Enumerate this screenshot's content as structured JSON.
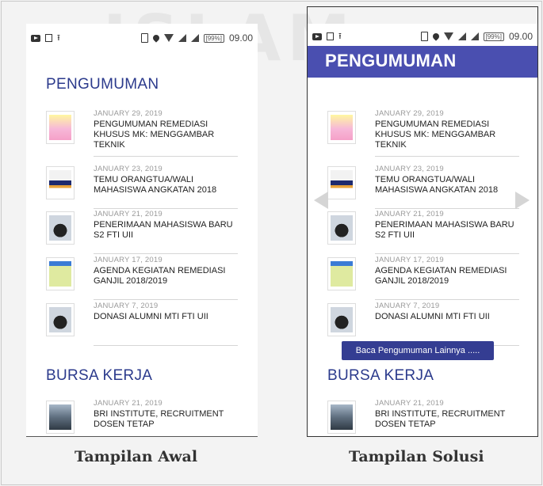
{
  "status": {
    "time": "09.00",
    "battery_label": "[99%]"
  },
  "left_panel": {
    "section_title": "PENGUMUMAN",
    "second_section_title": "BURSA KERJA",
    "caption": "Tampilan Awal"
  },
  "right_panel": {
    "section_title": "PENGUMUMAN",
    "second_section_title": "BURSA KERJA",
    "more_button": "Baca Pengumuman Lainnya .....",
    "caption": "Tampilan Solusi"
  },
  "announcements": [
    {
      "date": "JANUARY 29, 2019",
      "title": "PENGUMUMAN REMEDIASI KHUSUS MK: MENGGAMBAR TEKNIK",
      "thumb": "flyer"
    },
    {
      "date": "JANUARY 23, 2019",
      "title": "TEMU ORANGTUA/WALI MAHASISWA ANGKATAN 2018",
      "thumb": "banner"
    },
    {
      "date": "JANUARY 21, 2019",
      "title": "PENERIMAAN MAHASISWA BARU S2 FTI UII",
      "thumb": "grad-cap"
    },
    {
      "date": "JANUARY 17, 2019",
      "title": "AGENDA KEGIATAN REMEDIASI GANJIL 2018/2019",
      "thumb": "schedule"
    },
    {
      "date": "JANUARY 7, 2019",
      "title": "DONASI ALUMNI MTI FTI UII",
      "thumb": "grad-cap"
    }
  ],
  "jobs": [
    {
      "date": "JANUARY 21, 2019",
      "title": "BRI INSTITUTE, RECRUITMENT DOSEN TETAP",
      "thumb": "building"
    }
  ],
  "watermark": "ISLAM"
}
